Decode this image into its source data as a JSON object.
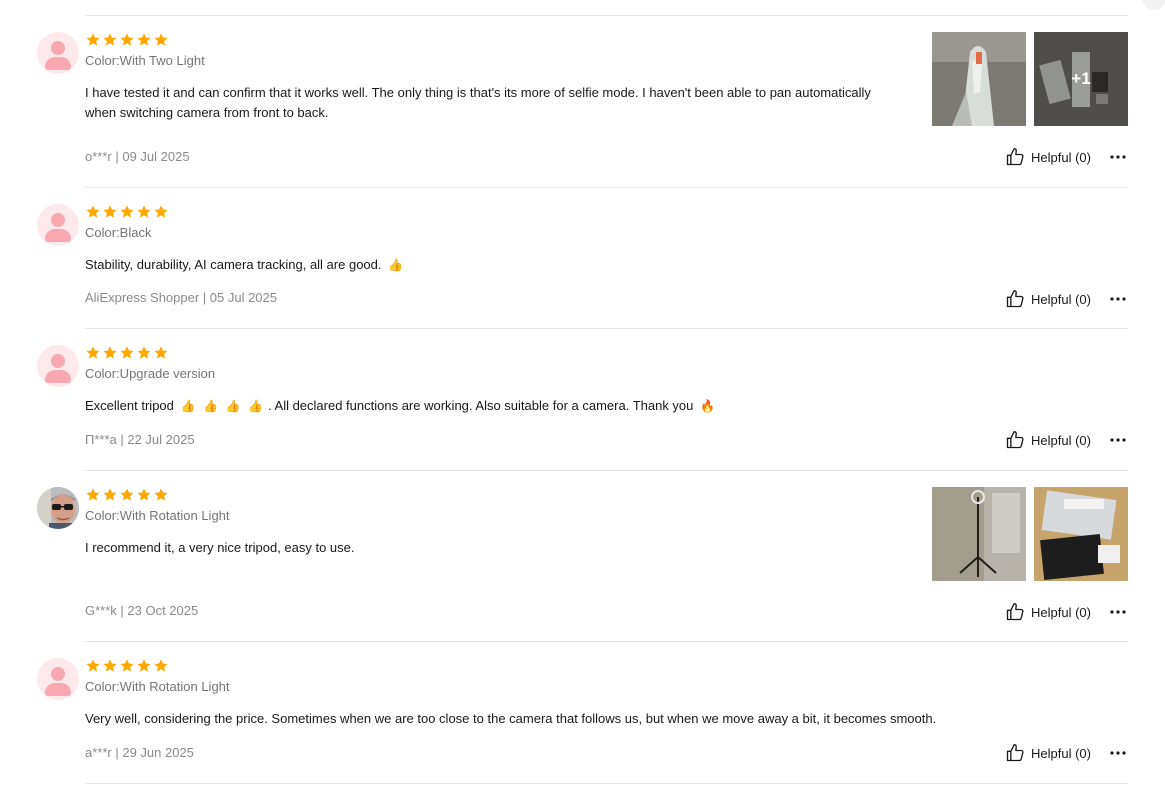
{
  "reviews": [
    {
      "rating": 5,
      "avatar": "default",
      "color_label": "Color:With Two Light",
      "text": "I have tested it and can confirm that it works well. The only thing is that's its more of selfie mode. I haven't been able to pan automatically when switching camera from front to back.",
      "meta": "o***r | 09 Jul 2025",
      "helpful": "Helpful (0)",
      "photos_extra": "+1"
    },
    {
      "rating": 5,
      "avatar": "default",
      "color_label": "Color:Black",
      "text": "Stability, durability, AI camera tracking, all are good.",
      "meta": "AliExpress Shopper | 05 Jul 2025",
      "helpful": "Helpful (0)"
    },
    {
      "rating": 5,
      "avatar": "default",
      "color_label": "Color:Upgrade version",
      "text_start": "Excellent tripod",
      "text_middle": ". All declared functions are working. Also suitable for a camera. Thank you",
      "meta": "П***a | 22 Jul 2025",
      "helpful": "Helpful (0)"
    },
    {
      "rating": 5,
      "avatar": "photo",
      "color_label": "Color:With Rotation Light",
      "text": "I recommend it, a very nice tripod, easy to use.",
      "meta": "G***k | 23 Oct 2025",
      "helpful": "Helpful (0)"
    },
    {
      "rating": 5,
      "avatar": "default",
      "color_label": "Color:With Rotation Light",
      "text": "Very well, considering the price. Sometimes when we are too close to the camera that follows us, but when we move away a bit, it becomes smooth.",
      "meta": "a***r | 29 Jun 2025",
      "helpful": "Helpful (0)"
    }
  ],
  "icons": {
    "star": "star-icon",
    "helpful": "thumbs-up-icon",
    "more": "more-icon",
    "thumbs_emoji": "thumbs-up-emoji",
    "fire_emoji": "fire-emoji"
  },
  "colors": {
    "star": "#fea800",
    "meta_text": "#8a8a8a",
    "divider": "#e5e5e5",
    "avatar_bg": "#fde9ec",
    "avatar_fg": "#f7a8b1"
  }
}
